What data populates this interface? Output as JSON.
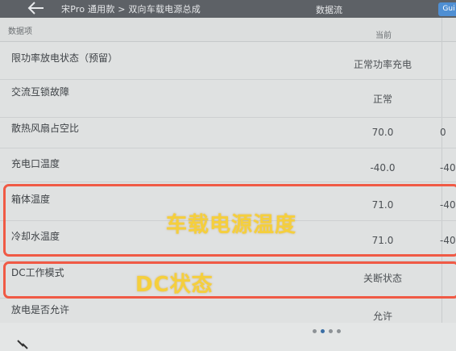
{
  "header": {
    "breadcrumb": "宋Pro 通用款 > 双向车载电源总成",
    "title": "数据流",
    "button_label": "Gui"
  },
  "table": {
    "col_item": "数据项",
    "col_current": "当前",
    "rows": [
      {
        "label": "限功率放电状态（预留）",
        "value": "正常功率充电",
        "extra": ""
      },
      {
        "label": "交流互锁故障",
        "value": "正常",
        "extra": ""
      },
      {
        "label": "散热风扇占空比",
        "value": "70.0",
        "extra": "0"
      },
      {
        "label": "充电口温度",
        "value": "-40.0",
        "extra": "-40"
      },
      {
        "label": "箱体温度",
        "value": "71.0",
        "extra": "-40"
      },
      {
        "label": "冷却水温度",
        "value": "71.0",
        "extra": "-40"
      },
      {
        "label": "DC工作模式",
        "value": "关断状态",
        "extra": ""
      },
      {
        "label": "放电是否允许",
        "value": "允许",
        "extra": ""
      }
    ]
  },
  "annotations": {
    "vehicle_power_temp": "车载电源温度",
    "dc_status": "DC状态"
  },
  "colors": {
    "highlight": "#f05a45",
    "overlay_text": "#f5cf3c",
    "topbar": "#5d6166",
    "button": "#4f8fd3"
  },
  "pagination": {
    "pages": 4,
    "current": 2
  }
}
